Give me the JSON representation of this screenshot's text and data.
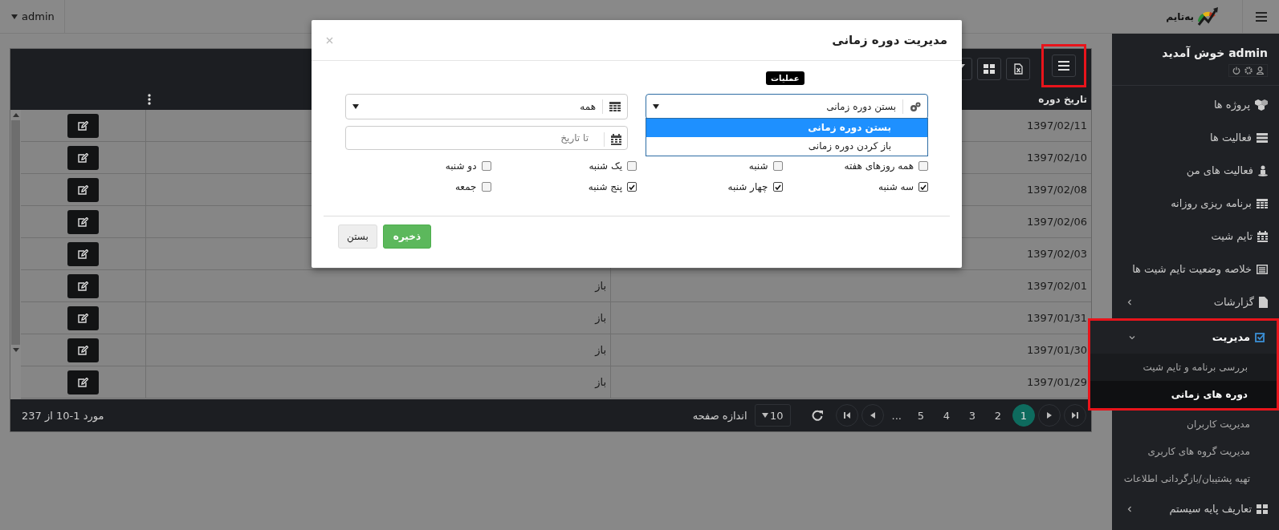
{
  "topbar": {
    "logo_text": "به‌تایم",
    "user_menu": "admin"
  },
  "sidebar": {
    "welcome": "admin خوش آمدید",
    "items": [
      {
        "label": "پروژه ها",
        "selected": false
      },
      {
        "label": "فعالیت ها",
        "selected": false
      },
      {
        "label": "فعالیت های من",
        "selected": false
      },
      {
        "label": "برنامه ریزی روزانه",
        "selected": false
      },
      {
        "label": "تایم شیت",
        "selected": false
      },
      {
        "label": "خلاصه وضعیت تایم شیت ها",
        "selected": false
      },
      {
        "label": "گزارشات",
        "selected": false,
        "expanded": false
      },
      {
        "label": "مدیریت",
        "selected": true,
        "expanded": true,
        "highlighted": true,
        "children": [
          {
            "label": "بررسی برنامه و تایم شیت",
            "selected": false,
            "highlighted": true
          },
          {
            "label": "دوره های زمانی",
            "selected": true,
            "highlighted": true
          },
          {
            "label": "مدیریت کاربران",
            "selected": false,
            "highlighted": false
          },
          {
            "label": "مدیریت گروه های کاربری",
            "selected": false,
            "highlighted": false
          },
          {
            "label": "تهیه پشتیبان/بازگردانی اطلاعات",
            "selected": false,
            "highlighted": false
          }
        ]
      },
      {
        "label": "تعاریف پایه سیستم",
        "selected": false,
        "expanded": false
      }
    ]
  },
  "toolbar": {
    "buttons": [
      {
        "highlighted": true
      },
      {
        "highlighted": false
      },
      {
        "highlighted": false
      },
      {
        "highlighted": false
      }
    ]
  },
  "table": {
    "columns": [
      "تاریخ دوره"
    ],
    "rows": [
      {
        "date": "1397/02/11"
      },
      {
        "date": "1397/02/10"
      },
      {
        "date": "1397/02/08"
      },
      {
        "date": "1397/02/06"
      },
      {
        "date": "1397/02/03"
      },
      {
        "date": "1397/02/01",
        "status": "باز"
      },
      {
        "date": "1397/01/31",
        "status": "باز"
      },
      {
        "date": "1397/01/30",
        "status": "باز"
      },
      {
        "date": "1397/01/29",
        "status": "باز"
      }
    ]
  },
  "pager": {
    "pages": [
      {
        "label": "1",
        "selected": true
      },
      {
        "label": "2",
        "selected": false
      },
      {
        "label": "3",
        "selected": false
      },
      {
        "label": "4",
        "selected": false
      },
      {
        "label": "5",
        "selected": false
      }
    ],
    "ellipsis": "...",
    "page_size": "10",
    "page_size_label": "اندازه صفحه",
    "summary": "مورد 1-10 از 237"
  },
  "modal": {
    "title": "مدیریت دوره زمانی",
    "operation": {
      "tooltip": "عملیات",
      "value": "بستن دوره زمانی",
      "open": true,
      "options": [
        {
          "label": "بستن دوره زمانی",
          "selected": true
        },
        {
          "label": "باز کردن دوره زمانی",
          "selected": false
        }
      ]
    },
    "filter_select": {
      "value": "همه"
    },
    "to_date": {
      "placeholder": "تا تاریخ"
    },
    "days": [
      {
        "label": "همه روزهای هفته",
        "checked": false
      },
      {
        "label": "شنبه",
        "checked": false
      },
      {
        "label": "یک شنبه",
        "checked": false
      },
      {
        "label": "دو شنبه",
        "checked": false
      },
      {
        "label": "سه شنبه",
        "checked": true
      },
      {
        "label": "چهار شنبه",
        "checked": true
      },
      {
        "label": "پنج شنبه",
        "checked": true
      },
      {
        "label": "جمعه",
        "checked": false
      }
    ],
    "buttons": [
      {
        "label": "ذخیره",
        "kind": "primary"
      },
      {
        "label": "بستن",
        "kind": "default"
      }
    ]
  }
}
